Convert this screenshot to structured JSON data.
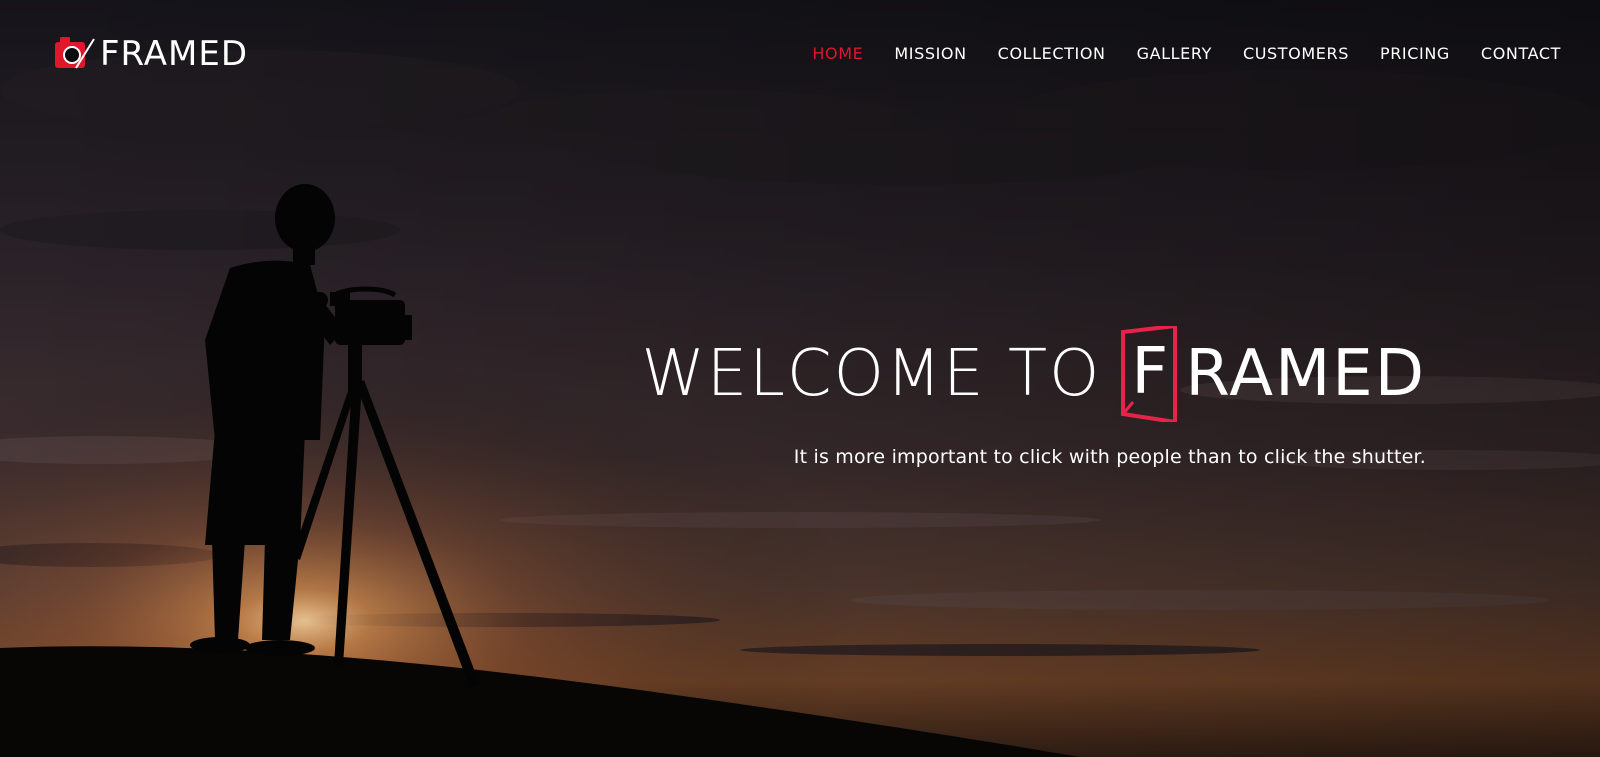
{
  "brand": {
    "logo_text": "FRAMED",
    "logo_icon": "camera-icon",
    "accent_color": "#e0162b"
  },
  "nav": {
    "items": [
      {
        "label": "HOME",
        "active": true
      },
      {
        "label": "MISSION",
        "active": false
      },
      {
        "label": "COLLECTION",
        "active": false
      },
      {
        "label": "GALLERY",
        "active": false
      },
      {
        "label": "CUSTOMERS",
        "active": false
      },
      {
        "label": "PRICING",
        "active": false
      },
      {
        "label": "CONTACT",
        "active": false
      }
    ]
  },
  "hero": {
    "headline_prefix": "WELCOME TO",
    "headline_brand_initial": "F",
    "headline_brand_rest": "RAMED",
    "tagline": "It is more important to click with people than to click the shutter.",
    "background_image": "videographer-silhouette-sunset"
  }
}
